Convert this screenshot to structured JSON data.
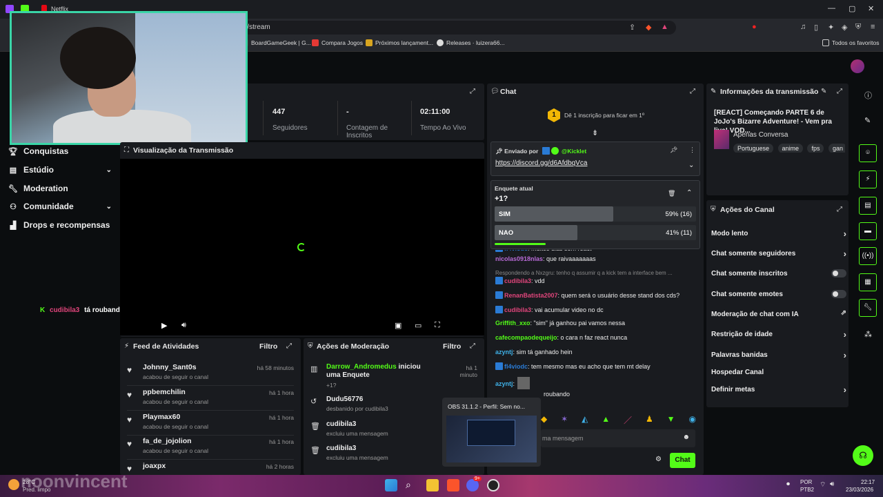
{
  "browser": {
    "tabs": [
      "Netflix"
    ],
    "url": "m/stream",
    "bookmarks": [
      "BoardGameGeek | G...",
      "Compara Jogos",
      "Próximos lançament...",
      "Releases · luizera66..."
    ],
    "favorites": "Todos os favoritos"
  },
  "overlay": {
    "user": "cudibila3",
    "text": "tá roubando"
  },
  "sidebar": {
    "items": [
      {
        "label": "Conquistas",
        "icon": "trophy-icon"
      },
      {
        "label": "Estúdio",
        "icon": "studio-icon"
      },
      {
        "label": "Moderation",
        "icon": "wrench-icon"
      },
      {
        "label": "Comunidade",
        "icon": "community-icon"
      },
      {
        "label": "Drops e recompensas",
        "icon": "drops-icon"
      }
    ]
  },
  "stats": [
    {
      "value": "447",
      "label": "Seguidores"
    },
    {
      "value": "-",
      "label": "Contagem de Inscritos"
    },
    {
      "value": "02:11:00",
      "label": "Tempo Ao Vivo"
    }
  ],
  "preview": {
    "title": "Visualização da Transmissão"
  },
  "feed": {
    "title": "Feed de Atividades",
    "filter": "Filtro",
    "items": [
      {
        "name": "Johnny_Sant0s",
        "sub": "acabou de seguir o canal",
        "time": "há 58 minutos"
      },
      {
        "name": "ppbemchilin",
        "sub": "acabou de seguir o canal",
        "time": "há 1 hora"
      },
      {
        "name": "Playmax60",
        "sub": "acabou de seguir o canal",
        "time": "há 1 hora"
      },
      {
        "name": "fa_de_jojolion",
        "sub": "acabou de seguir o canal",
        "time": "há 1 hora"
      },
      {
        "name": "joaxpx",
        "sub": "",
        "time": "há 2 horas"
      }
    ]
  },
  "mod": {
    "title": "Ações de Moderação",
    "filter": "Filtro",
    "items": [
      {
        "user": "Darrow_Andromedus",
        "action": "iniciou uma Enquete",
        "sub": "+1?",
        "time": "há 1 minuto"
      },
      {
        "user": "Dudu56776",
        "action": "",
        "sub": "desbanido por cudibila3",
        "time": ""
      },
      {
        "user": "cudibila3",
        "action": "",
        "sub": "excluiu uma mensagem",
        "time": ""
      },
      {
        "user": "cudibila3",
        "action": "",
        "sub": "excluiu uma mensagem",
        "time": ""
      }
    ]
  },
  "chat": {
    "title": "Chat",
    "sub_prompt": "Dê 1 inscrição para ficar em 1º",
    "rank": "1",
    "pinned": {
      "label": "Enviado por",
      "user": "@Kicklet",
      "link": "https://discord.gg/d6AfdbqVca"
    },
    "poll": {
      "label": "Enquete atual",
      "question": "+1?",
      "options": [
        {
          "label": "SIM",
          "pct_text": "59% (16)",
          "pct": 59
        },
        {
          "label": "NAO",
          "pct_text": "41% (11)",
          "pct": 41
        }
      ]
    },
    "messages": [
      {
        "user": "fl4viodc",
        "text": ": muitos dias sem react",
        "color": "#2a7bd5"
      },
      {
        "user": "nicolas0918nlas",
        "text": ": que raivaaaaaaas",
        "color": "#b86ad6"
      },
      {
        "user": "",
        "text": "Respondendo a Nxzgru: tenho q assumir q a kick tem a interface bem ...",
        "color": "#888"
      },
      {
        "user": "cudibila3",
        "text": ": vdd",
        "color": "#e0457b"
      },
      {
        "user": "RenanBatista2007",
        "text": ": quem será o usuário desse stand dos cds?",
        "color": "#e0457b"
      },
      {
        "user": "cudibila3",
        "text": ": vai acumular video no dc",
        "color": "#e0457b"
      },
      {
        "user": "Griffith_xxo",
        "text": ": \"sim\" já ganhou pai vamos nessa",
        "color": "#53fc18"
      },
      {
        "user": "cafecompaodequeijo",
        "text": ": o cara n faz react nunca",
        "color": "#53fc18"
      },
      {
        "user": "azyntj",
        "text": ": sim tá ganhado hein",
        "color": "#3fb1e8"
      },
      {
        "user": "fl4viodc",
        "text": ": tem mesmo mas eu acho que tem mt delay",
        "color": "#2a7bd5"
      },
      {
        "user": "azyntj",
        "text": ":",
        "color": "#3fb1e8"
      },
      {
        "user": "",
        "text": "roubando",
        "color": "#eee"
      }
    ],
    "input_placeholder": "ma mensagem",
    "send": "Chat"
  },
  "info": {
    "title": "Informações da transmissão",
    "stream_title": "[REACT] Começando PARTE 6 de JoJo's Bizarre Adventure! - Vem pra live! VOD...",
    "category": "Apenas Conversa",
    "tags": [
      "Portuguese",
      "anime",
      "fps",
      "gan"
    ]
  },
  "actions": {
    "title": "Ações do Canal",
    "items": [
      {
        "label": "Modo lento",
        "ctrl": "chev"
      },
      {
        "label": "Chat somente seguidores",
        "ctrl": "chev"
      },
      {
        "label": "Chat somente inscritos",
        "ctrl": "toggle"
      },
      {
        "label": "Chat somente emotes",
        "ctrl": "toggle"
      },
      {
        "label": "Moderação de chat com IA",
        "ctrl": "ext"
      },
      {
        "label": "Restrição de idade",
        "ctrl": "chev"
      },
      {
        "label": "Palavras banidas",
        "ctrl": "chev"
      },
      {
        "label": "Hospedar Canal",
        "ctrl": "none"
      },
      {
        "label": "Definir metas",
        "ctrl": "chev"
      }
    ]
  },
  "taskbar": {
    "weather": "28°C",
    "weather_sub": "Pred. limpo",
    "watermark": "noonvincent",
    "obs": "OBS 31.1.2 - Perfil: Sem no...",
    "lang": "POR",
    "lang_sub": "PTB2",
    "time": "22:17",
    "date": "23/03/2026",
    "notif": "9+"
  }
}
